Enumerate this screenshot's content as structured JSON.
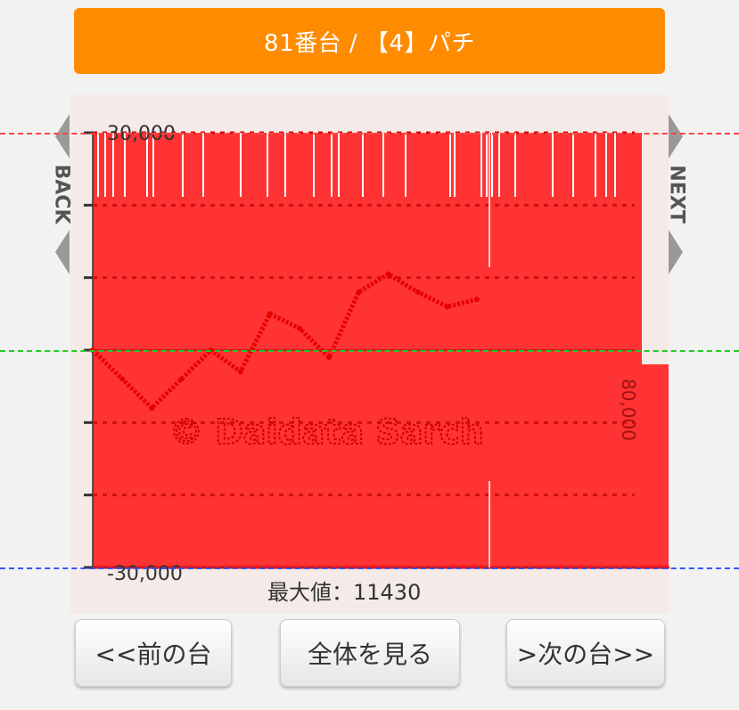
{
  "header": {
    "title": "81番台 / 【4】パチ"
  },
  "nav": {
    "back_label": "BACK",
    "next_label": "NEXT"
  },
  "chart_data": {
    "type": "line",
    "y_tick_labels": [
      "30,000",
      "-30,000"
    ],
    "right_label": "80,000",
    "ylim": [
      -30000,
      30000
    ],
    "grid": true,
    "series": [
      {
        "values": [
          0,
          -4000,
          -8000,
          -4000,
          0,
          -3000,
          5000,
          3000,
          -1000,
          8000,
          10500,
          8000,
          6000,
          7000
        ]
      }
    ],
    "watermark": "© Daidata Sarch",
    "max_label": "最大値：11430",
    "colors": {
      "fill": "#ff3333",
      "line": "#e60000",
      "bg": "#f4ebe8",
      "zero_guide": "#22cc22",
      "top_guide": "#ff4444",
      "bottom_guide": "#3355ff"
    }
  },
  "buttons": {
    "prev": "<<前の台",
    "all": "全体を見る",
    "next": ">次の台>>"
  }
}
